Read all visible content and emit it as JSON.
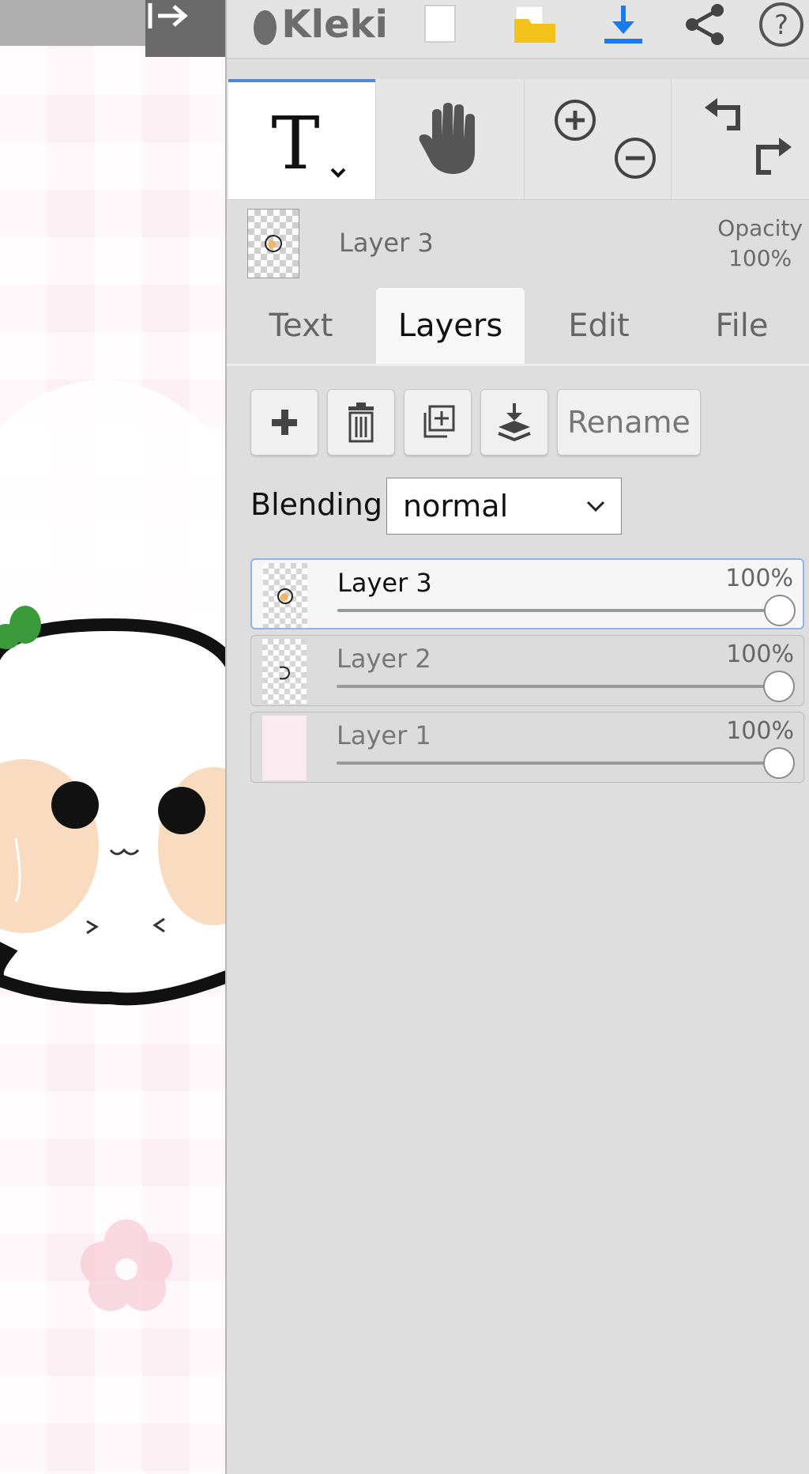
{
  "app": {
    "name": "Kleki",
    "collapse_icon": "collapse-right-icon",
    "top_icons": [
      "new-file-icon",
      "open-folder-icon",
      "download-icon",
      "share-icon",
      "help-icon"
    ],
    "accent_color": "#4f86d6"
  },
  "tools": {
    "items": [
      {
        "name": "text-tool",
        "icon": "text-T-icon",
        "selected": true
      },
      {
        "name": "hand-tool",
        "icon": "hand-icon",
        "selected": false
      },
      {
        "name": "zoom",
        "icon": "zoom-in-out-icon",
        "selected": false
      },
      {
        "name": "undo-redo",
        "icon": "undo-redo-icon",
        "selected": false
      }
    ]
  },
  "current_layer": {
    "name": "Layer 3",
    "opacity_label": "Opacity",
    "opacity_value": "100%"
  },
  "tabs": [
    {
      "label": "Text",
      "active": false
    },
    {
      "label": "Layers",
      "active": true
    },
    {
      "label": "Edit",
      "active": false
    },
    {
      "label": "File",
      "active": false
    }
  ],
  "layer_actions": {
    "add_icon": "plus-icon",
    "delete_icon": "trash-icon",
    "duplicate_icon": "duplicate-icon",
    "merge_icon": "merge-down-icon",
    "rename_label": "Rename"
  },
  "blending": {
    "label": "Blending",
    "value": "normal"
  },
  "layers": [
    {
      "name": "Layer 3",
      "opacity_label": "100%",
      "opacity": 1.0,
      "active": true
    },
    {
      "name": "Layer 2",
      "opacity_label": "100%",
      "opacity": 1.0,
      "active": false
    },
    {
      "name": "Layer 1",
      "opacity_label": "100%",
      "opacity": 1.0,
      "active": false
    }
  ]
}
